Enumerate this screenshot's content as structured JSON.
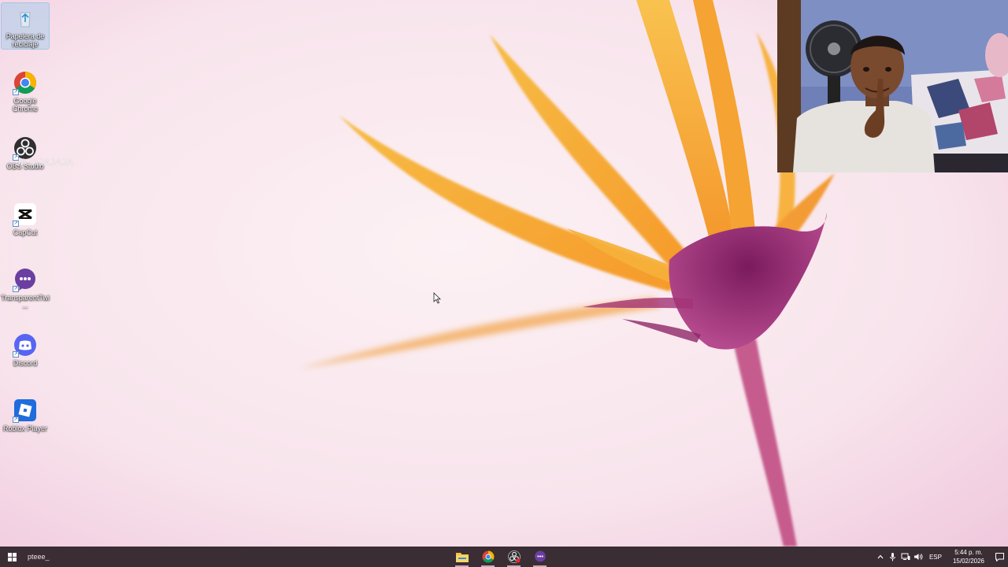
{
  "desktop": {
    "icons": [
      {
        "label": "Papelera de reciclaje",
        "icon": "recycle-bin-icon"
      },
      {
        "label": "Google Chrome",
        "icon": "chrome-icon"
      },
      {
        "label": "OBS Studio",
        "icon": "obs-icon"
      },
      {
        "label": "CapCut",
        "icon": "capcut-icon"
      },
      {
        "label": "TransparentTwi...",
        "icon": "transparent-twitch-chat-icon"
      },
      {
        "label": "Discord",
        "icon": "discord-icon"
      },
      {
        "label": "Roblox Player",
        "icon": "roblox-icon"
      }
    ],
    "overlay_text": "JAJAJAJAJA"
  },
  "taskbar": {
    "search_text": "pteee_",
    "apps": [
      "file-explorer-icon",
      "chrome-icon",
      "obs-icon",
      "transparent-twitch-chat-icon"
    ],
    "language": "ESP",
    "time": "5:44 p. m.",
    "date": "15/02/2026"
  },
  "colors": {
    "taskbar": "#3a2d33",
    "accent": "#c9a9bd",
    "discord": "#5865f2",
    "chat_purple": "#6b3fa0",
    "roblox": "#1f6cdd"
  }
}
